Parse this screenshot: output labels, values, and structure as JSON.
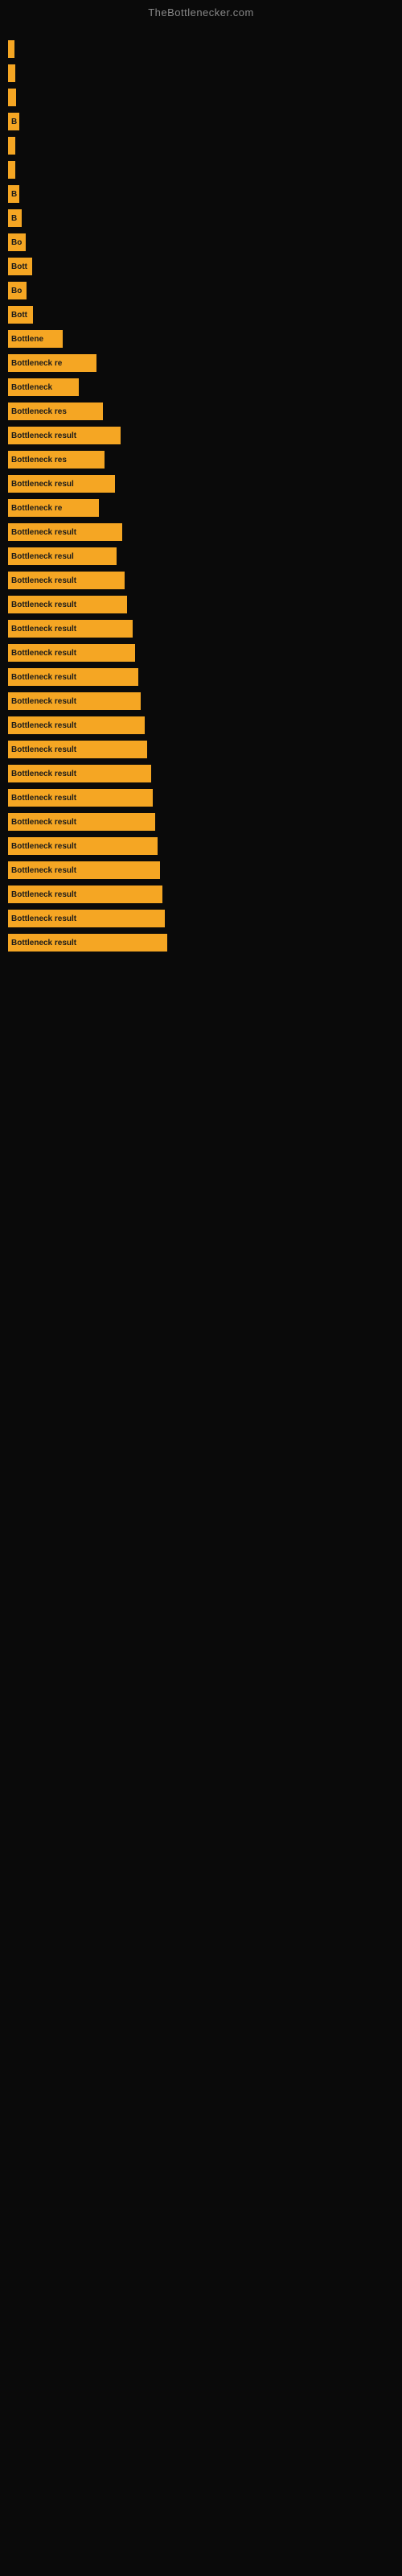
{
  "site": {
    "title": "TheBottlenecker.com"
  },
  "bars": [
    {
      "label": "",
      "width": 8
    },
    {
      "label": "",
      "width": 9
    },
    {
      "label": "",
      "width": 10
    },
    {
      "label": "B",
      "width": 14
    },
    {
      "label": "",
      "width": 9
    },
    {
      "label": "",
      "width": 9
    },
    {
      "label": "B",
      "width": 14
    },
    {
      "label": "B",
      "width": 17
    },
    {
      "label": "Bo",
      "width": 22
    },
    {
      "label": "Bott",
      "width": 30
    },
    {
      "label": "Bo",
      "width": 23
    },
    {
      "label": "Bott",
      "width": 31
    },
    {
      "label": "Bottlene",
      "width": 68
    },
    {
      "label": "Bottleneck re",
      "width": 110
    },
    {
      "label": "Bottleneck",
      "width": 88
    },
    {
      "label": "Bottleneck res",
      "width": 118
    },
    {
      "label": "Bottleneck result",
      "width": 140
    },
    {
      "label": "Bottleneck res",
      "width": 120
    },
    {
      "label": "Bottleneck resul",
      "width": 133
    },
    {
      "label": "Bottleneck re",
      "width": 113
    },
    {
      "label": "Bottleneck result",
      "width": 142
    },
    {
      "label": "Bottleneck resul",
      "width": 135
    },
    {
      "label": "Bottleneck result",
      "width": 145
    },
    {
      "label": "Bottleneck result",
      "width": 148
    },
    {
      "label": "Bottleneck result",
      "width": 155
    },
    {
      "label": "Bottleneck result",
      "width": 158
    },
    {
      "label": "Bottleneck result",
      "width": 162
    },
    {
      "label": "Bottleneck result",
      "width": 165
    },
    {
      "label": "Bottleneck result",
      "width": 170
    },
    {
      "label": "Bottleneck result",
      "width": 173
    },
    {
      "label": "Bottleneck result",
      "width": 178
    },
    {
      "label": "Bottleneck result",
      "width": 180
    },
    {
      "label": "Bottleneck result",
      "width": 183
    },
    {
      "label": "Bottleneck result",
      "width": 186
    },
    {
      "label": "Bottleneck result",
      "width": 189
    },
    {
      "label": "Bottleneck result",
      "width": 192
    },
    {
      "label": "Bottleneck result",
      "width": 195
    },
    {
      "label": "Bottleneck result",
      "width": 198
    }
  ]
}
